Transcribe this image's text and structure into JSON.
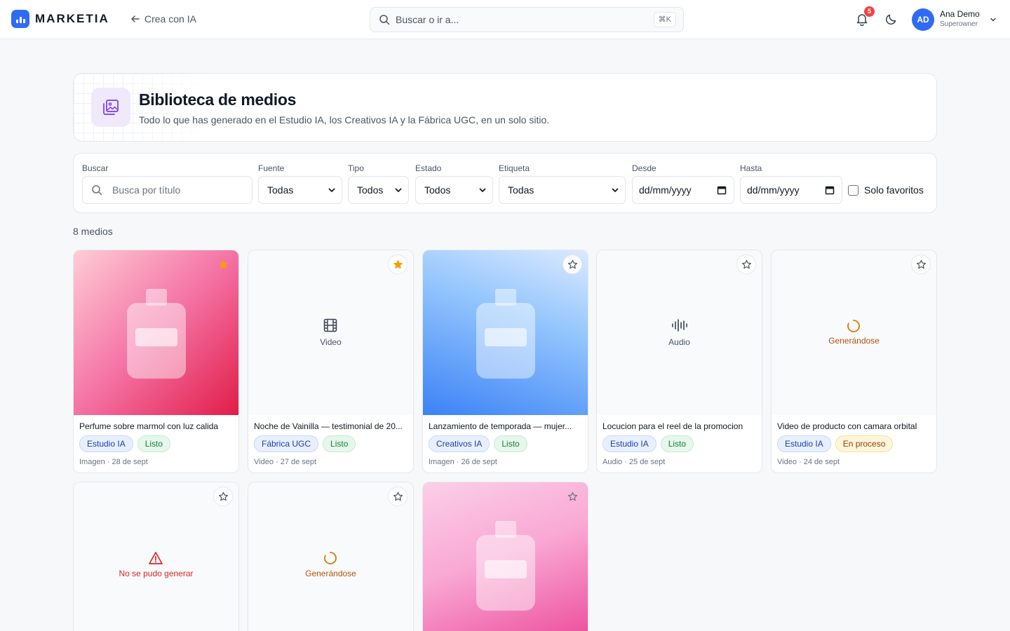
{
  "app": {
    "brand": "MARKETIA",
    "back_label": "Crea con IA",
    "search_placeholder": "Buscar o ir a...",
    "shortcut": "⌘K",
    "notifications_count": "5",
    "user": {
      "initials": "AD",
      "name": "Ana Demo",
      "role": "Superowner"
    },
    "accent_color": "#2f6bf6"
  },
  "hero": {
    "title": "Biblioteca de medios",
    "subtitle": "Todo lo que has generado en el Estudio IA, los Creativos IA y la Fábrica UGC, en un solo sitio."
  },
  "filters": {
    "search": {
      "label": "Buscar",
      "placeholder": "Busca por título"
    },
    "source": {
      "label": "Fuente",
      "value": "Todas"
    },
    "type": {
      "label": "Tipo",
      "value": "Todos"
    },
    "status": {
      "label": "Estado",
      "value": "Todos"
    },
    "tag": {
      "label": "Etiqueta",
      "value": "Todas"
    },
    "from": {
      "label": "Desde",
      "value": "dd/mm/yyyy"
    },
    "to": {
      "label": "Hasta",
      "value": "dd/mm/yyyy"
    },
    "favorites_label": "Solo favoritos"
  },
  "count_label": "8 medios",
  "cards": [
    {
      "title": "Perfume sobre marmol con luz calida",
      "source": "Estudio IA",
      "status": "Listo",
      "meta": "Imagen · 28 de sept",
      "favorite": true,
      "thumb": "image-pink"
    },
    {
      "title": "Noche de Vainilla — testimonial de 20...",
      "source": "Fábrica UGC",
      "status": "Listo",
      "meta": "Video · 27 de sept",
      "favorite": true,
      "thumb": "video-placeholder",
      "placeholder_label": "Video"
    },
    {
      "title": "Lanzamiento de temporada — mujer...",
      "source": "Creativos IA",
      "status": "Listo",
      "meta": "Imagen · 26 de sept",
      "favorite": false,
      "thumb": "image-blue"
    },
    {
      "title": "Locucion para el reel de la promocion",
      "source": "Estudio IA",
      "status": "Listo",
      "meta": "Audio · 25 de sept",
      "favorite": false,
      "thumb": "audio-placeholder",
      "placeholder_label": "Audio"
    },
    {
      "title": "Video de producto con camara orbital",
      "source": "Estudio IA",
      "status": "En proceso",
      "meta": "Video · 24 de sept",
      "favorite": false,
      "thumb": "generating",
      "placeholder_label": "Generándose"
    },
    {
      "thumb": "error",
      "placeholder_label": "No se pudo generar",
      "favorite": false
    },
    {
      "thumb": "generating",
      "placeholder_label": "Generándose",
      "favorite": false
    },
    {
      "thumb": "image-pink2",
      "favorite": false
    }
  ]
}
